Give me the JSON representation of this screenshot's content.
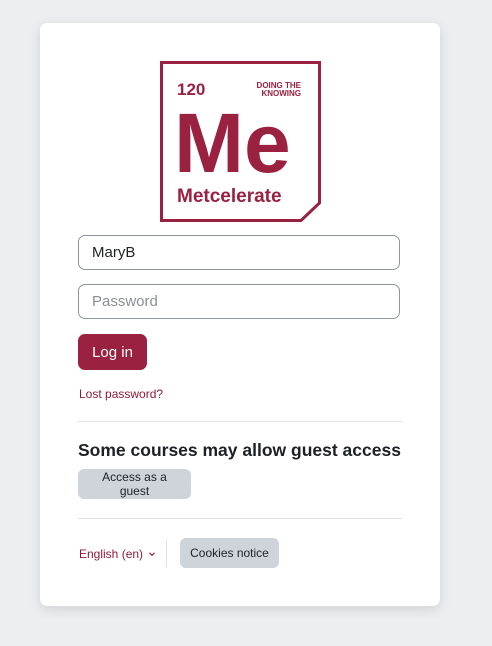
{
  "logo": {
    "number": "120",
    "tagline_line1": "DOING THE",
    "tagline_line2": "KNOWING",
    "symbol": "Me",
    "name": "Metcelerate",
    "color": "#9a2140"
  },
  "login": {
    "username_value": "MaryB",
    "password_placeholder": "Password",
    "login_button": "Log in",
    "lost_password": "Lost password?"
  },
  "guest": {
    "heading": "Some courses may allow guest access",
    "button": "Access as a guest"
  },
  "footer": {
    "language": "English (en)",
    "language_icon": "chevron-down-icon",
    "cookies_button": "Cookies notice"
  },
  "colors": {
    "brand": "#9a2140",
    "link": "#8b1d3b",
    "secondary_button": "#ced4da",
    "background": "#eceef1"
  }
}
